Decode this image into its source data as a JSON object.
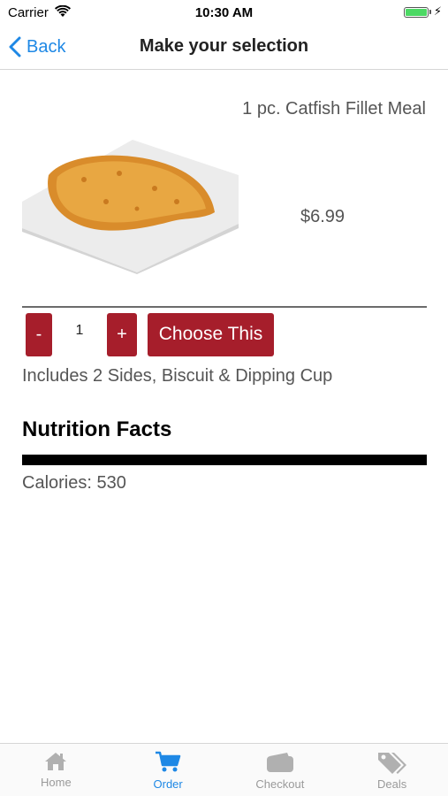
{
  "status_bar": {
    "carrier": "Carrier",
    "time": "10:30 AM",
    "battery_level": 1.0
  },
  "nav": {
    "back_label": "Back",
    "title": "Make your selection"
  },
  "item": {
    "name": "1 pc. Catfish Fillet Meal",
    "price": "$6.99",
    "quantity": "1",
    "minus_label": "-",
    "plus_label": "+",
    "choose_label": "Choose This",
    "includes": "Includes 2 Sides, Biscuit & Dipping Cup"
  },
  "nutrition": {
    "title": "Nutrition Facts",
    "calories": "Calories: 530"
  },
  "tabs": [
    {
      "label": "Home",
      "icon": "home-icon",
      "active": false
    },
    {
      "label": "Order",
      "icon": "cart-icon",
      "active": true
    },
    {
      "label": "Checkout",
      "icon": "wallet-icon",
      "active": false
    },
    {
      "label": "Deals",
      "icon": "tags-icon",
      "active": false
    }
  ],
  "colors": {
    "accent_blue": "#1e88e5",
    "button_red": "#a61e2b",
    "inactive_gray": "#9a9a9a"
  }
}
